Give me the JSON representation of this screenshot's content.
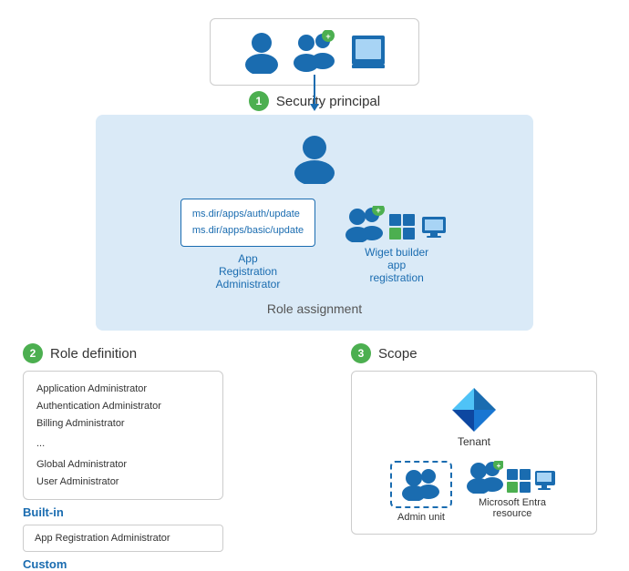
{
  "security_principal": {
    "label": "Security principal",
    "circle_num": "1"
  },
  "role_assignment": {
    "label": "Role assignment",
    "role_box_lines": [
      "ms.dir/apps/auth/update",
      "ms.dir/apps/basic/update"
    ],
    "role_name": "App Registration Administrator",
    "wiget_label": "Wiget builder\napp registration",
    "person_icon_label": ""
  },
  "role_definition": {
    "section_label": "Role definition",
    "circle_num": "2",
    "builtin_items": [
      "Application Administrator",
      "Authentication Administrator",
      "Billing Administrator",
      "...",
      "Global Administrator",
      "User Administrator"
    ],
    "builtin_label": "Built-in",
    "custom_box_text": "App Registration Administrator",
    "custom_label": "Custom"
  },
  "scope": {
    "section_label": "Scope",
    "circle_num": "3",
    "tenant_label": "Tenant",
    "admin_unit_label": "Admin unit",
    "ms_entra_label": "Microsoft Entra\nresource"
  }
}
